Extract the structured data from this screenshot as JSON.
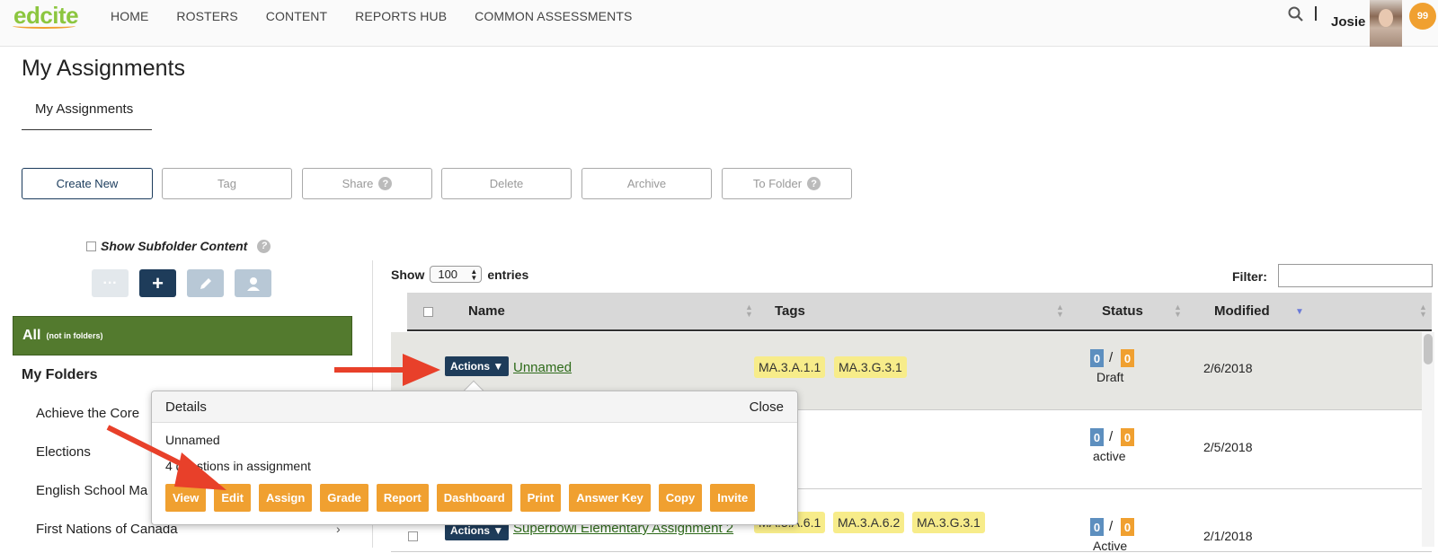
{
  "nav": {
    "logo": "edcite",
    "items": [
      "HOME",
      "ROSTERS",
      "CONTENT",
      "REPORTS HUB",
      "COMMON ASSESSMENTS"
    ],
    "user": "Josie",
    "points": "99"
  },
  "page": {
    "title": "My Assignments",
    "subtab": "My Assignments"
  },
  "toolbar": {
    "create_new": "Create New",
    "tag": "Tag",
    "share": "Share",
    "delete": "Delete",
    "archive": "Archive",
    "to_folder": "To Folder",
    "help_glyph": "?"
  },
  "sidebar": {
    "show_subfolder": "Show Subfolder Content",
    "help_glyph": "?",
    "all_label": "All",
    "all_note": "(not in folders)",
    "my_folders": "My Folders",
    "folders": [
      "Achieve the Core",
      "Elections",
      "English School Ma",
      "First Nations of Canada"
    ],
    "more_glyph": "···",
    "add_glyph": "+"
  },
  "table": {
    "show": "Show",
    "entries_value": "100",
    "entries": "entries",
    "filter": "Filter:",
    "columns": [
      "Name",
      "Tags",
      "Status",
      "Modified"
    ],
    "rows": [
      {
        "actions": "Actions ▼",
        "name": "Unnamed",
        "tags": [
          "MA.3.A.1.1",
          "MA.3.G.3.1"
        ],
        "submitted": "0",
        "total": "0",
        "status": "Draft",
        "modified": "2/6/2018"
      },
      {
        "submitted": "0",
        "total": "0",
        "status": "active",
        "modified": "2/5/2018"
      },
      {
        "actions": "Actions ▼",
        "name": "Superbowl Elementary Assignment 2",
        "tags": [
          "MA.3.A.6.1",
          "MA.3.A.6.2",
          "MA.3.G.3.1"
        ],
        "submitted": "0",
        "total": "0",
        "status": "Active",
        "modified": "2/1/2018"
      }
    ]
  },
  "popup": {
    "title": "Details",
    "close": "Close",
    "name": "Unnamed",
    "count": "4 questions in assignment",
    "buttons": [
      "View",
      "Edit",
      "Assign",
      "Grade",
      "Report",
      "Dashboard",
      "Print",
      "Answer Key",
      "Copy",
      "Invite"
    ]
  },
  "colors": {
    "accent_green": "#537a2e",
    "navy": "#1e3c5a",
    "orange": "#f0a030",
    "tag_yellow": "#f7ec8a",
    "arrow_red": "#e8402a"
  }
}
